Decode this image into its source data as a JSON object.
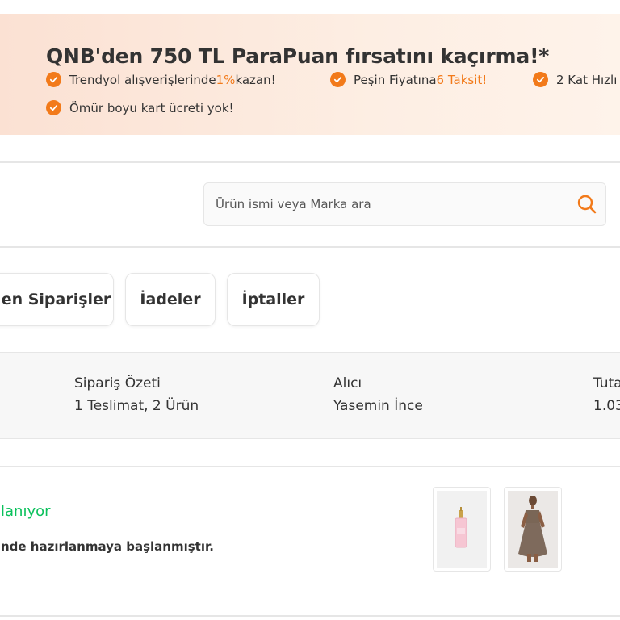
{
  "promo": {
    "title": "QNB'den 750 TL ParaPuan fırsatını kaçırma!*",
    "benefits": [
      {
        "before": "Trendyol alışverişlerinde ",
        "highlight": "1%",
        "after": " kazan!"
      },
      {
        "before": "Peşin Fiyatına ",
        "highlight": "6 Taksit!",
        "after": ""
      },
      {
        "before": "2 Kat Hızlı",
        "highlight": "",
        "after": ""
      },
      {
        "before": "Ömür boyu kart ücreti yok!",
        "highlight": "",
        "after": ""
      }
    ],
    "accent_color": "#f27a1a"
  },
  "search": {
    "placeholder": "Ürün ismi veya Marka ara",
    "icon": "search-icon"
  },
  "tabs": [
    {
      "label": "en Siparişler"
    },
    {
      "label": "İadeler"
    },
    {
      "label": "İptaller"
    }
  ],
  "order": {
    "summary_label": "Sipariş Özeti",
    "summary_value": "1 Teslimat, 2 Ürün",
    "recipient_label": "Alıcı",
    "recipient_value": "Yasemin İnce",
    "total_label": "Tuta",
    "total_value": "1.03",
    "status": "lanıyor",
    "status_color": "#0bc15c",
    "status_description": "nde hazırlanmaya başlanmıştır.",
    "products": [
      {
        "name": "pink-perfume-image"
      },
      {
        "name": "model-dress-image"
      }
    ]
  }
}
